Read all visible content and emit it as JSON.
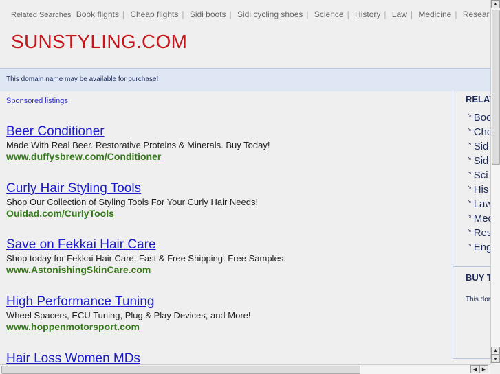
{
  "related_searches": {
    "label": "Related Searches",
    "links": [
      "Book flights",
      "Cheap flights",
      "Sidi boots",
      "Sidi cycling shoes",
      "Science",
      "History",
      "Law",
      "Medicine",
      "Research"
    ]
  },
  "site_title": "SUNSTYLING.COM",
  "availability_notice": "This domain name may be available for purchase!",
  "sponsored_label": "Sponsored listings",
  "listings": [
    {
      "title": "Beer Conditioner",
      "desc": "Made With Real Beer. Restorative Proteins & Minerals. Buy Today!",
      "url": "www.duffysbrew.com/Conditioner"
    },
    {
      "title": "Curly Hair Styling Tools",
      "desc": "Shop Our Collection of Styling Tools For Your Curly Hair Needs!",
      "url": "Ouidad.com/CurlyTools"
    },
    {
      "title": "Save on Fekkai Hair Care",
      "desc": "Shop today for Fekkai Hair Care. Fast & Free Shipping. Free Samples.",
      "url": "www.AstonishingSkinCare.com"
    },
    {
      "title": "High Performance Tuning",
      "desc": "Wheel Spacers, ECU Tuning, Plug & Play Devices, and More!",
      "url": "www.hoppenmotorsport.com"
    },
    {
      "title": "Hair Loss Women MDs"
    }
  ],
  "sidebar": {
    "related_heading": "RELAT",
    "items": [
      "Boo",
      "Che",
      "Sid",
      "Sid",
      "Sci",
      "His",
      "Law",
      "Med",
      "Res",
      "Eng"
    ],
    "arrow": "↘",
    "buy_heading": "BUY T",
    "buy_text": "This dor"
  },
  "scroll": {
    "up": "▲",
    "down": "▼",
    "left": "◀",
    "right": "▶"
  }
}
